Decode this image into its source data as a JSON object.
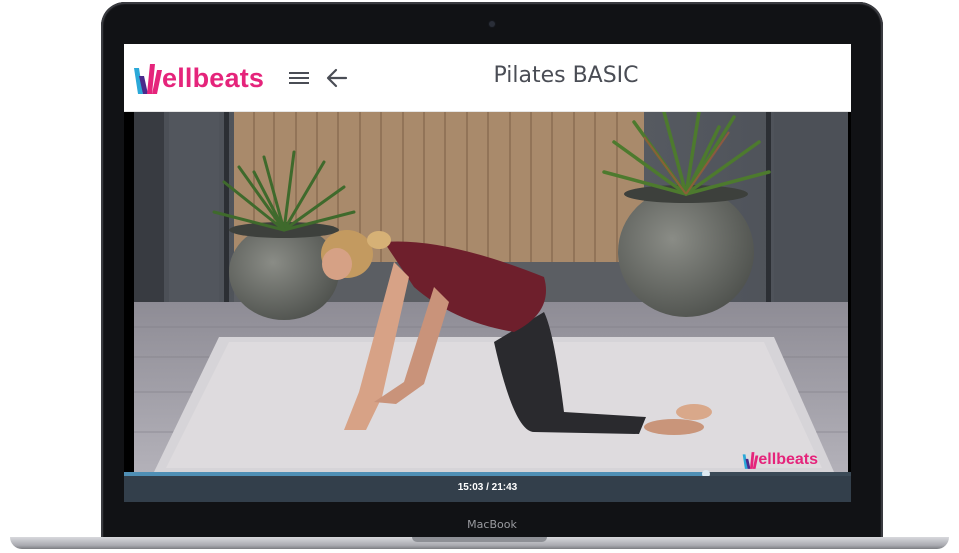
{
  "app": {
    "logo_text": "ellbeats",
    "title": "Pilates BASIC"
  },
  "header": {
    "menu_icon": "hamburger-menu-icon",
    "back_icon": "arrow-left-icon"
  },
  "player": {
    "watermark_text": "ellbeats",
    "time": "15:03 / 21:43",
    "progress_fraction": 0.8
  },
  "device": {
    "label": "MacBook"
  },
  "colors": {
    "brand_pink": "#e5247b",
    "brand_purple": "#4b2a8c",
    "brand_blue": "#2aa8d8",
    "controls_bg": "#333f4b",
    "progress_fill": "#4f8fb5"
  }
}
